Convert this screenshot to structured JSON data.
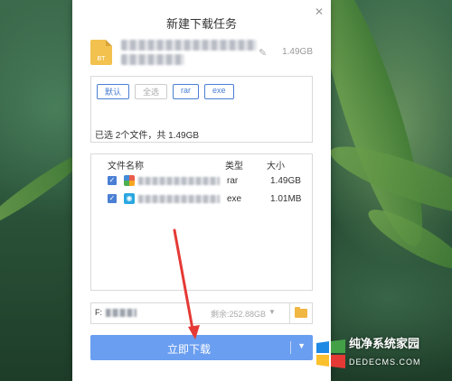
{
  "dialog": {
    "title": "新建下载任务",
    "close_icon": "close-icon"
  },
  "torrent": {
    "icon_label": "BT",
    "total_size": "1.49GB"
  },
  "filters": {
    "chips": [
      "默认",
      "全选",
      "rar",
      "exe"
    ],
    "summary": "已选 2个文件，共 1.49GB"
  },
  "file_list": {
    "headers": {
      "name": "文件名称",
      "type": "类型",
      "size": "大小"
    },
    "rows": [
      {
        "checked": true,
        "icon": "rar-file-icon",
        "type": "rar",
        "size": "1.49GB"
      },
      {
        "checked": true,
        "icon": "exe-file-icon",
        "type": "exe",
        "size": "1.01MB"
      }
    ]
  },
  "save_path": {
    "drive": "F:",
    "free_space": "剩余:252.88GB"
  },
  "download": {
    "label": "立即下载"
  },
  "watermark": {
    "line1": "纯净系统家园",
    "line2": "DEDECMS.COM"
  },
  "colors": {
    "accent": "#4a7fd4",
    "button": "#6a9ef0",
    "arrow": "#e53935"
  }
}
